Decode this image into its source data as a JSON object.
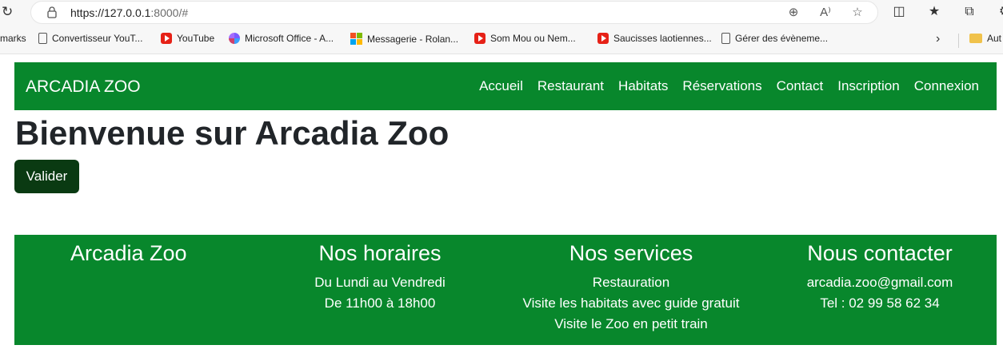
{
  "browser": {
    "url_host": "https://127.0.0.1",
    "url_rest": ":8000/#",
    "bookmarks": [
      {
        "label": "marks",
        "icon": "none"
      },
      {
        "label": "Convertisseur YouT...",
        "icon": "page-icon"
      },
      {
        "label": "YouTube",
        "icon": "youtube-icon"
      },
      {
        "label": "Microsoft Office - A...",
        "icon": "microsoft-office-icon"
      },
      {
        "label": "Messagerie - Rolan...",
        "icon": "windows-icon"
      },
      {
        "label": "Som Mou ou Nem...",
        "icon": "youtube-icon"
      },
      {
        "label": "Saucisses laotiennes...",
        "icon": "youtube-icon"
      },
      {
        "label": "Gérer des évèneme...",
        "icon": "page-icon"
      },
      {
        "label": "Aut",
        "icon": "folder-icon"
      }
    ]
  },
  "site": {
    "brand": "ARCADIA ZOO",
    "nav": [
      "Accueil",
      "Restaurant",
      "Habitats",
      "Réservations",
      "Contact",
      "Inscription",
      "Connexion"
    ],
    "title": "Bienvenue sur Arcadia Zoo",
    "button": "Valider",
    "colors": {
      "primary": "#08872c",
      "button": "#0a3a12"
    }
  },
  "footer": {
    "brand": "Arcadia Zoo",
    "hours_title": "Nos horaires",
    "hours": [
      "Du Lundi au Vendredi",
      "De 11h00 à 18h00"
    ],
    "services_title": "Nos services",
    "services": [
      "Restauration",
      "Visite les habitats avec guide gratuit",
      "Visite le Zoo en petit train"
    ],
    "contact_title": "Nous contacter",
    "contact": [
      "arcadia.zoo@gmail.com",
      "Tel : 02 99 58 62 34"
    ]
  }
}
